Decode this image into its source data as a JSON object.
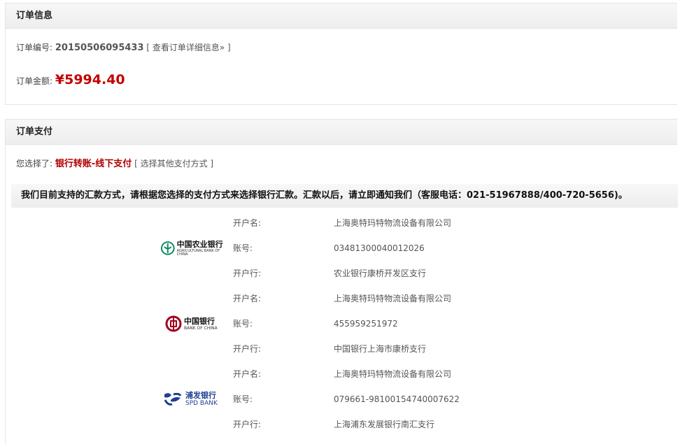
{
  "order": {
    "title": "订单信息",
    "number_label": "订单编号:",
    "number": "20150506095433",
    "detail_link": "[ 查看订单详细信息» ]",
    "amount_label": "订单金额:",
    "amount": "¥5994.40"
  },
  "payment": {
    "title": "订单支付",
    "chosen_label": "您选择了:",
    "method": "银行转账-线下支付",
    "other_link": "[ 选择其他支付方式 ]",
    "notice": "我们目前支持的汇款方式，请根据您选择的支付方式来选择银行汇款。汇款以后，请立即通知我们（客服电话：021-51967888/400-720-5656)。",
    "banks": [
      {
        "logo_icon": "abc-logo-icon",
        "logo_cn": "中国农业银行",
        "logo_en": "AGRICULTURAL BANK OF CHINA",
        "color": "#0a8a5c",
        "rows": [
          {
            "label": "开户名:",
            "value": "上海奥特玛特物流设备有限公司"
          },
          {
            "label": "账号:",
            "value": "03481300040012026"
          },
          {
            "label": "开户行:",
            "value": "农业银行康桥开发区支行"
          }
        ]
      },
      {
        "logo_icon": "boc-logo-icon",
        "logo_cn": "中国银行",
        "logo_en": "BANK OF CHINA",
        "color": "#a3001e",
        "rows": [
          {
            "label": "开户名:",
            "value": "上海奥特玛特物流设备有限公司"
          },
          {
            "label": "账号:",
            "value": "455959251972"
          },
          {
            "label": "开户行:",
            "value": "中国银行上海市康桥支行"
          }
        ]
      },
      {
        "logo_icon": "spdb-logo-icon",
        "logo_cn": "浦发银行",
        "logo_en": "SPD BANK",
        "color": "#1f3f94",
        "rows": [
          {
            "label": "开户名:",
            "value": "上海奥特玛特物流设备有限公司"
          },
          {
            "label": "账号:",
            "value": "079661-98100154740007622"
          },
          {
            "label": "开户行:",
            "value": "上海浦东发展银行南汇支行"
          }
        ]
      }
    ]
  }
}
